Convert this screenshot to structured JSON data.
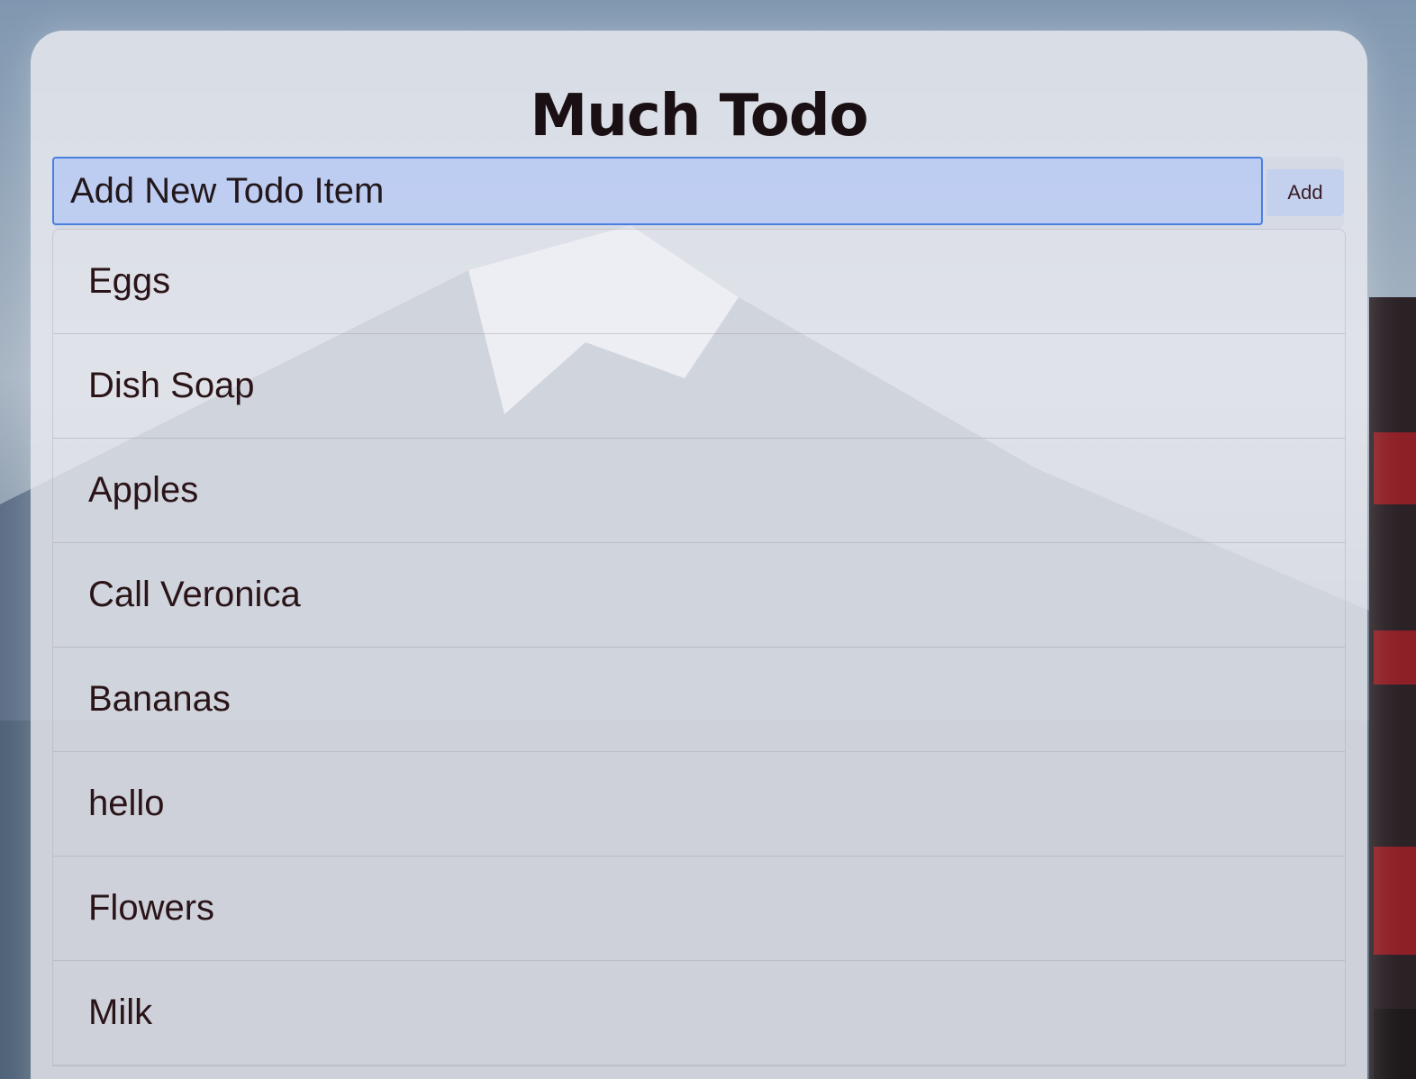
{
  "app": {
    "title": "Much Todo"
  },
  "add_form": {
    "input_placeholder": "Add New Todo Item",
    "input_value": "",
    "add_label": "Add"
  },
  "todos": [
    {
      "label": "Eggs"
    },
    {
      "label": "Dish Soap"
    },
    {
      "label": "Apples"
    },
    {
      "label": "Call Veronica"
    },
    {
      "label": "Bananas"
    },
    {
      "label": "hello"
    },
    {
      "label": "Flowers"
    },
    {
      "label": "Milk"
    }
  ],
  "colors": {
    "accent_focus": "#4a7fe0",
    "input_fill": "#b8cbf4",
    "text": "#2a1418",
    "title_text": "#1a0f12"
  }
}
